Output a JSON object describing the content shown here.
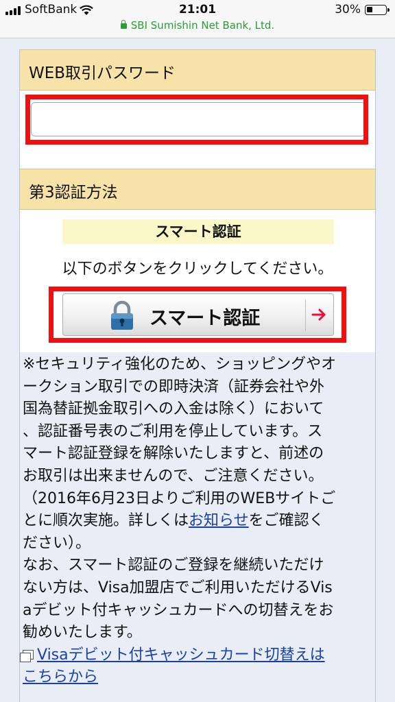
{
  "status_bar": {
    "carrier": "SoftBank",
    "time": "21:01",
    "battery_percent": "30%",
    "battery_level": 0.3,
    "url": "SBI Sumishin Net Bank, Ltd."
  },
  "password_section": {
    "heading": "WEB取引パスワード",
    "input_value": "",
    "input_placeholder": ""
  },
  "auth_section": {
    "heading": "第3認証方法",
    "subtitle": "スマート認証",
    "instruction": "以下のボタンをクリックしてください。",
    "button_label": "スマート認証"
  },
  "notice": {
    "lines": [
      "※セキュリティ強化のため、ショッピングやオ",
      "ークション取引での即時決済（証券会社や外",
      "国為替証拠金取引への入金は除く）において",
      "、認証番号表のご利用を停止しています。ス",
      "マート認証登録を解除いたしますと、前述の",
      "お取引は出来ませんので、ご注意ください。",
      "（2016年6月23日よりご利用のWEBサイトご"
    ],
    "line8_before": "とに順次実施。詳しくは",
    "line8_link": "お知らせ",
    "line8_after": "をご確認く",
    "lines_after": [
      "ださい）。",
      "なお、スマート認証のご登録を継続いただけ",
      "ない方は、Visa加盟店でご利用いただけるVis",
      "aデビット付キャッシュカードへの切替えをお",
      "勧めいたします。"
    ],
    "link_line1": "Visaデビット付キャッシュカード切替えは",
    "link_line2": "こちらから"
  },
  "colors": {
    "section_heading_bg": "#f7e3a8",
    "highlight_red": "#ee1111",
    "link_blue": "#1a3fa8",
    "secure_green": "#2a9d34"
  }
}
